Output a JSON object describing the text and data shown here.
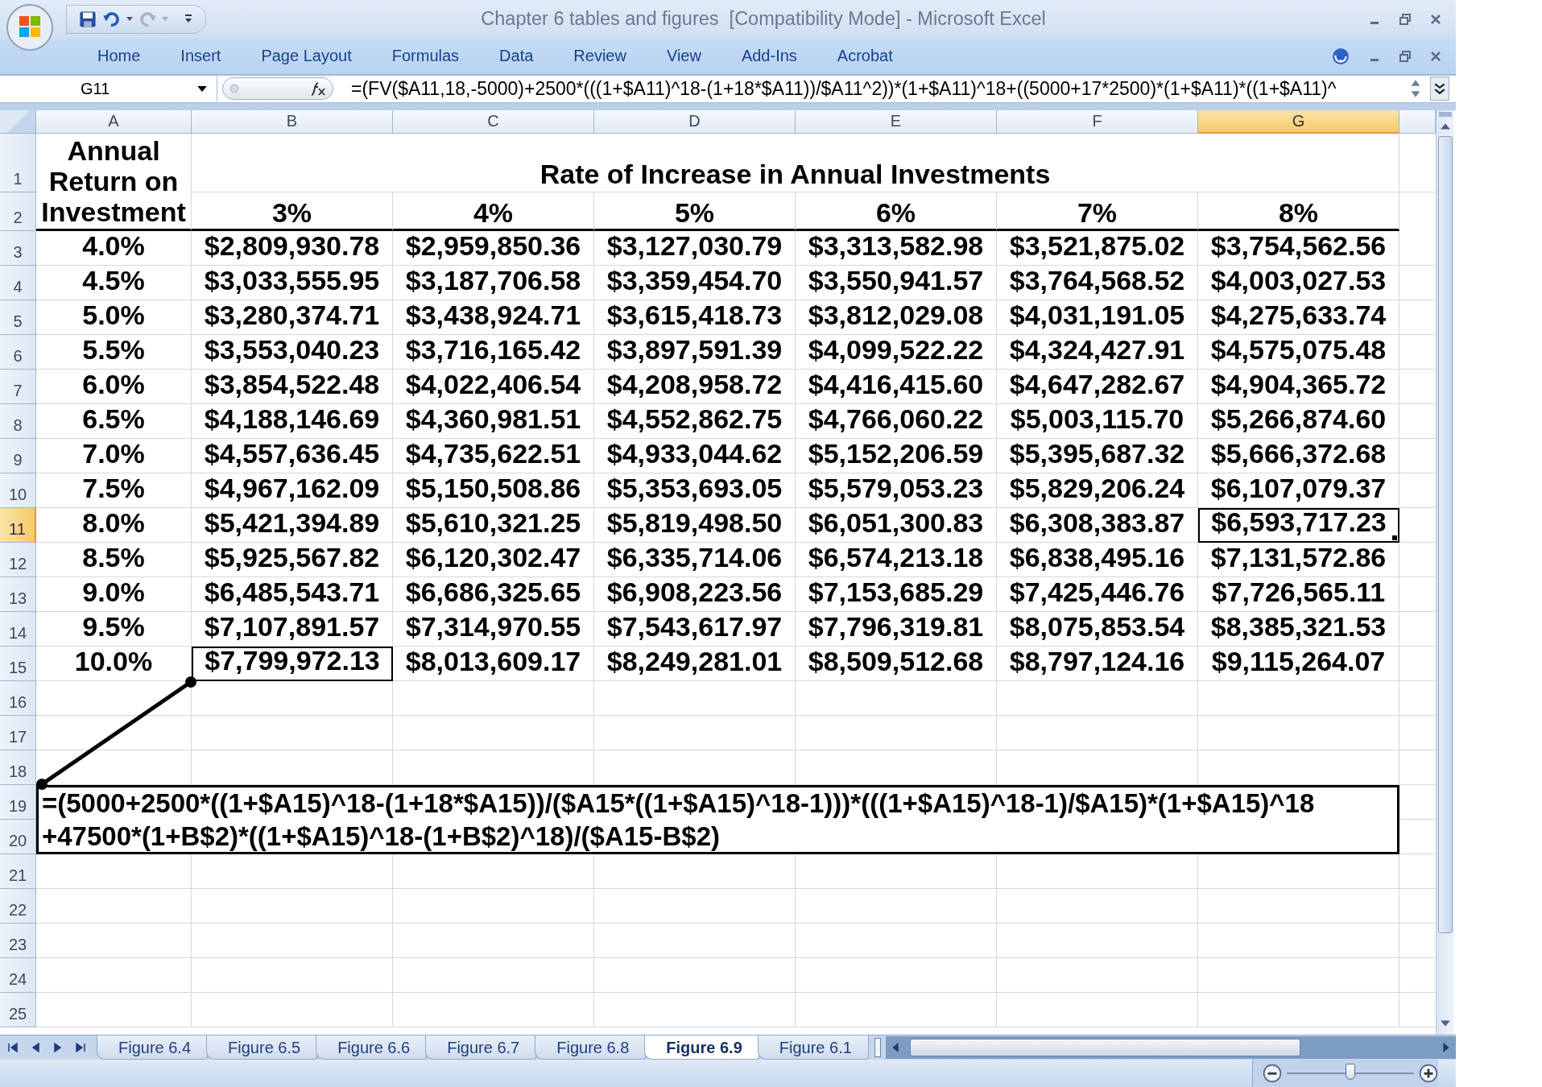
{
  "window": {
    "title": "Chapter 6 tables and figures  [Compatibility Mode] - Microsoft Excel"
  },
  "ribbon_tabs": [
    {
      "label": "Home"
    },
    {
      "label": "Insert"
    },
    {
      "label": "Page Layout"
    },
    {
      "label": "Formulas"
    },
    {
      "label": "Data"
    },
    {
      "label": "Review"
    },
    {
      "label": "View"
    },
    {
      "label": "Add-Ins"
    },
    {
      "label": "Acrobat"
    }
  ],
  "formula_bar": {
    "name_box": "G11",
    "formula": "=(FV($A11,18,-5000)+2500*(((1+$A11)^18-(1+18*$A11))/$A11^2))*(1+$A11)^18+((5000+17*2500)*(1+$A11)*((1+$A11)^"
  },
  "sheet": {
    "columns": [
      {
        "label": "A",
        "selected": false
      },
      {
        "label": "B",
        "selected": false
      },
      {
        "label": "C",
        "selected": false
      },
      {
        "label": "D",
        "selected": false
      },
      {
        "label": "E",
        "selected": false
      },
      {
        "label": "F",
        "selected": false
      },
      {
        "label": "G",
        "selected": true
      }
    ],
    "header_rows": {
      "row_numbers": [
        {
          "label": "1",
          "selected": false
        },
        {
          "label": "2",
          "selected": false
        }
      ],
      "corner_label": "Annual Return on Investment",
      "title": "Rate of Increase in Annual Investments",
      "rates": [
        "3%",
        "4%",
        "5%",
        "6%",
        "7%",
        "8%"
      ]
    },
    "data_rows": [
      {
        "number": "3",
        "selected": false,
        "rate": "4.0%",
        "cells": [
          {
            "text": "$2,809,930.78",
            "selected": false,
            "outlined": false
          },
          {
            "text": "$2,959,850.36",
            "selected": false,
            "outlined": false
          },
          {
            "text": "$3,127,030.79",
            "selected": false,
            "outlined": false
          },
          {
            "text": "$3,313,582.98",
            "selected": false,
            "outlined": false
          },
          {
            "text": "$3,521,875.02",
            "selected": false,
            "outlined": false
          },
          {
            "text": "$3,754,562.56",
            "selected": false,
            "outlined": false
          }
        ]
      },
      {
        "number": "4",
        "selected": false,
        "rate": "4.5%",
        "cells": [
          {
            "text": "$3,033,555.95",
            "selected": false,
            "outlined": false
          },
          {
            "text": "$3,187,706.58",
            "selected": false,
            "outlined": false
          },
          {
            "text": "$3,359,454.70",
            "selected": false,
            "outlined": false
          },
          {
            "text": "$3,550,941.57",
            "selected": false,
            "outlined": false
          },
          {
            "text": "$3,764,568.52",
            "selected": false,
            "outlined": false
          },
          {
            "text": "$4,003,027.53",
            "selected": false,
            "outlined": false
          }
        ]
      },
      {
        "number": "5",
        "selected": false,
        "rate": "5.0%",
        "cells": [
          {
            "text": "$3,280,374.71",
            "selected": false,
            "outlined": false
          },
          {
            "text": "$3,438,924.71",
            "selected": false,
            "outlined": false
          },
          {
            "text": "$3,615,418.73",
            "selected": false,
            "outlined": false
          },
          {
            "text": "$3,812,029.08",
            "selected": false,
            "outlined": false
          },
          {
            "text": "$4,031,191.05",
            "selected": false,
            "outlined": false
          },
          {
            "text": "$4,275,633.74",
            "selected": false,
            "outlined": false
          }
        ]
      },
      {
        "number": "6",
        "selected": false,
        "rate": "5.5%",
        "cells": [
          {
            "text": "$3,553,040.23",
            "selected": false,
            "outlined": false
          },
          {
            "text": "$3,716,165.42",
            "selected": false,
            "outlined": false
          },
          {
            "text": "$3,897,591.39",
            "selected": false,
            "outlined": false
          },
          {
            "text": "$4,099,522.22",
            "selected": false,
            "outlined": false
          },
          {
            "text": "$4,324,427.91",
            "selected": false,
            "outlined": false
          },
          {
            "text": "$4,575,075.48",
            "selected": false,
            "outlined": false
          }
        ]
      },
      {
        "number": "7",
        "selected": false,
        "rate": "6.0%",
        "cells": [
          {
            "text": "$3,854,522.48",
            "selected": false,
            "outlined": false
          },
          {
            "text": "$4,022,406.54",
            "selected": false,
            "outlined": false
          },
          {
            "text": "$4,208,958.72",
            "selected": false,
            "outlined": false
          },
          {
            "text": "$4,416,415.60",
            "selected": false,
            "outlined": false
          },
          {
            "text": "$4,647,282.67",
            "selected": false,
            "outlined": false
          },
          {
            "text": "$4,904,365.72",
            "selected": false,
            "outlined": false
          }
        ]
      },
      {
        "number": "8",
        "selected": false,
        "rate": "6.5%",
        "cells": [
          {
            "text": "$4,188,146.69",
            "selected": false,
            "outlined": false
          },
          {
            "text": "$4,360,981.51",
            "selected": false,
            "outlined": false
          },
          {
            "text": "$4,552,862.75",
            "selected": false,
            "outlined": false
          },
          {
            "text": "$4,766,060.22",
            "selected": false,
            "outlined": false
          },
          {
            "text": "$5,003,115.70",
            "selected": false,
            "outlined": false
          },
          {
            "text": "$5,266,874.60",
            "selected": false,
            "outlined": false
          }
        ]
      },
      {
        "number": "9",
        "selected": false,
        "rate": "7.0%",
        "cells": [
          {
            "text": "$4,557,636.45",
            "selected": false,
            "outlined": false
          },
          {
            "text": "$4,735,622.51",
            "selected": false,
            "outlined": false
          },
          {
            "text": "$4,933,044.62",
            "selected": false,
            "outlined": false
          },
          {
            "text": "$5,152,206.59",
            "selected": false,
            "outlined": false
          },
          {
            "text": "$5,395,687.32",
            "selected": false,
            "outlined": false
          },
          {
            "text": "$5,666,372.68",
            "selected": false,
            "outlined": false
          }
        ]
      },
      {
        "number": "10",
        "selected": false,
        "rate": "7.5%",
        "cells": [
          {
            "text": "$4,967,162.09",
            "selected": false,
            "outlined": false
          },
          {
            "text": "$5,150,508.86",
            "selected": false,
            "outlined": false
          },
          {
            "text": "$5,353,693.05",
            "selected": false,
            "outlined": false
          },
          {
            "text": "$5,579,053.23",
            "selected": false,
            "outlined": false
          },
          {
            "text": "$5,829,206.24",
            "selected": false,
            "outlined": false
          },
          {
            "text": "$6,107,079.37",
            "selected": false,
            "outlined": false
          }
        ]
      },
      {
        "number": "11",
        "selected": true,
        "rate": "8.0%",
        "cells": [
          {
            "text": "$5,421,394.89",
            "selected": false,
            "outlined": false
          },
          {
            "text": "$5,610,321.25",
            "selected": false,
            "outlined": false
          },
          {
            "text": "$5,819,498.50",
            "selected": false,
            "outlined": false
          },
          {
            "text": "$6,051,300.83",
            "selected": false,
            "outlined": false
          },
          {
            "text": "$6,308,383.87",
            "selected": false,
            "outlined": false
          },
          {
            "text": "$6,593,717.23",
            "selected": true,
            "outlined": false
          }
        ]
      },
      {
        "number": "12",
        "selected": false,
        "rate": "8.5%",
        "cells": [
          {
            "text": "$5,925,567.82",
            "selected": false,
            "outlined": false
          },
          {
            "text": "$6,120,302.47",
            "selected": false,
            "outlined": false
          },
          {
            "text": "$6,335,714.06",
            "selected": false,
            "outlined": false
          },
          {
            "text": "$6,574,213.18",
            "selected": false,
            "outlined": false
          },
          {
            "text": "$6,838,495.16",
            "selected": false,
            "outlined": false
          },
          {
            "text": "$7,131,572.86",
            "selected": false,
            "outlined": false
          }
        ]
      },
      {
        "number": "13",
        "selected": false,
        "rate": "9.0%",
        "cells": [
          {
            "text": "$6,485,543.71",
            "selected": false,
            "outlined": false
          },
          {
            "text": "$6,686,325.65",
            "selected": false,
            "outlined": false
          },
          {
            "text": "$6,908,223.56",
            "selected": false,
            "outlined": false
          },
          {
            "text": "$7,153,685.29",
            "selected": false,
            "outlined": false
          },
          {
            "text": "$7,425,446.76",
            "selected": false,
            "outlined": false
          },
          {
            "text": "$7,726,565.11",
            "selected": false,
            "outlined": false
          }
        ]
      },
      {
        "number": "14",
        "selected": false,
        "rate": "9.5%",
        "cells": [
          {
            "text": "$7,107,891.57",
            "selected": false,
            "outlined": false
          },
          {
            "text": "$7,314,970.55",
            "selected": false,
            "outlined": false
          },
          {
            "text": "$7,543,617.97",
            "selected": false,
            "outlined": false
          },
          {
            "text": "$7,796,319.81",
            "selected": false,
            "outlined": false
          },
          {
            "text": "$8,075,853.54",
            "selected": false,
            "outlined": false
          },
          {
            "text": "$8,385,321.53",
            "selected": false,
            "outlined": false
          }
        ]
      },
      {
        "number": "15",
        "selected": false,
        "rate": "10.0%",
        "cells": [
          {
            "text": "$7,799,972.13",
            "selected": false,
            "outlined": true
          },
          {
            "text": "$8,013,609.17",
            "selected": false,
            "outlined": false
          },
          {
            "text": "$8,249,281.01",
            "selected": false,
            "outlined": false
          },
          {
            "text": "$8,509,512.68",
            "selected": false,
            "outlined": false
          },
          {
            "text": "$8,797,124.16",
            "selected": false,
            "outlined": false
          },
          {
            "text": "$9,115,264.07",
            "selected": false,
            "outlined": false
          }
        ]
      }
    ],
    "empty_rows": [
      {
        "number": "16",
        "selected": false
      },
      {
        "number": "17",
        "selected": false
      },
      {
        "number": "18",
        "selected": false
      },
      {
        "number": "19",
        "selected": false
      },
      {
        "number": "20",
        "selected": false
      },
      {
        "number": "21",
        "selected": false
      },
      {
        "number": "22",
        "selected": false
      },
      {
        "number": "23",
        "selected": false
      },
      {
        "number": "24",
        "selected": false
      },
      {
        "number": "25",
        "selected": false
      }
    ],
    "note": {
      "lines": [
        "=(5000+2500*((1+$A15)^18-(1+18*$A15))/($A15*((1+$A15)^18-1)))*(((1+$A15)^18-1)/$A15)*(1+$A15)^18",
        "+47500*(1+B$2)*((1+$A15)^18-(1+B$2)^18)/($A15-B$2)"
      ]
    }
  },
  "sheet_tabs": [
    {
      "label": "Figure 6.4",
      "selected": false
    },
    {
      "label": "Figure 6.5",
      "selected": false
    },
    {
      "label": "Figure 6.6",
      "selected": false
    },
    {
      "label": "Figure 6.7",
      "selected": false
    },
    {
      "label": "Figure 6.8",
      "selected": false
    },
    {
      "label": "Figure 6.9",
      "selected": true
    },
    {
      "label": "Figure 6.1",
      "selected": false
    }
  ],
  "zoom_slider": {
    "level": 0.5
  }
}
